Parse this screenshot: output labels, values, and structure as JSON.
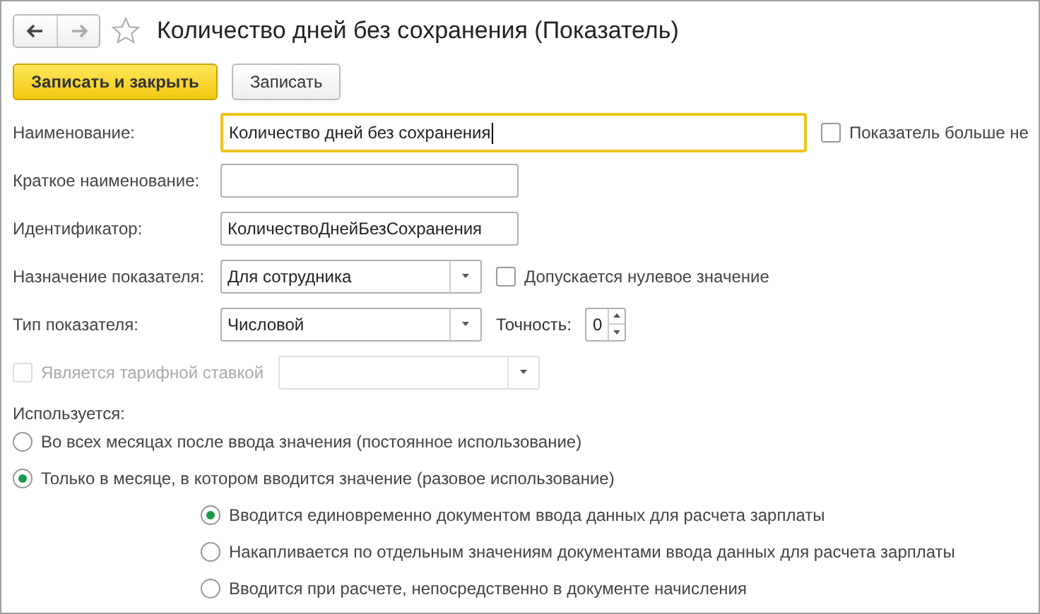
{
  "window": {
    "title": "Количество дней без сохранения (Показатель)",
    "favorite": false
  },
  "toolbar": {
    "buttons": [
      {
        "label": "Записать и закрыть",
        "primary": true
      },
      {
        "label": "Записать",
        "primary": false
      }
    ]
  },
  "form": {
    "name": {
      "label": "Наименование:",
      "value": "Количество дней без сохранения",
      "focused": true,
      "checkbox": {
        "label": "Показатель больше не",
        "checked": false
      }
    },
    "short_name": {
      "label": "Краткое наименование:"
    },
    "identifier": {
      "label": "Идентификатор:",
      "value": "КоличествоДнейБезСохранения"
    },
    "purpose": {
      "label": "Назначение показателя:",
      "value": "Для сотрудника",
      "checkbox": {
        "label": "Допускается нулевое значение",
        "checked": false
      }
    },
    "type": {
      "label": "Тип показателя:",
      "value": "Числовой",
      "precision_label": "Точность:",
      "precision": "0"
    },
    "tariff": {
      "label": "Является тарифной ставкой",
      "checked": false,
      "disabled": true
    },
    "usage": {
      "label": "Используется:",
      "options": [
        {
          "label": "Во всех месяцах после ввода значения (постоянное использование)",
          "selected": false
        },
        {
          "label": "Только в месяце, в котором вводится значение (разовое использование)",
          "selected": true,
          "children": [
            {
              "label": "Вводится единовременно документом ввода данных для расчета зарплаты",
              "selected": true
            },
            {
              "label": "Накапливается по отдельным значениям документами ввода данных для расчета зарплаты",
              "selected": false
            },
            {
              "label": "Вводится при расчете, непосредственно в документе начисления",
              "selected": false
            }
          ]
        }
      ]
    }
  }
}
